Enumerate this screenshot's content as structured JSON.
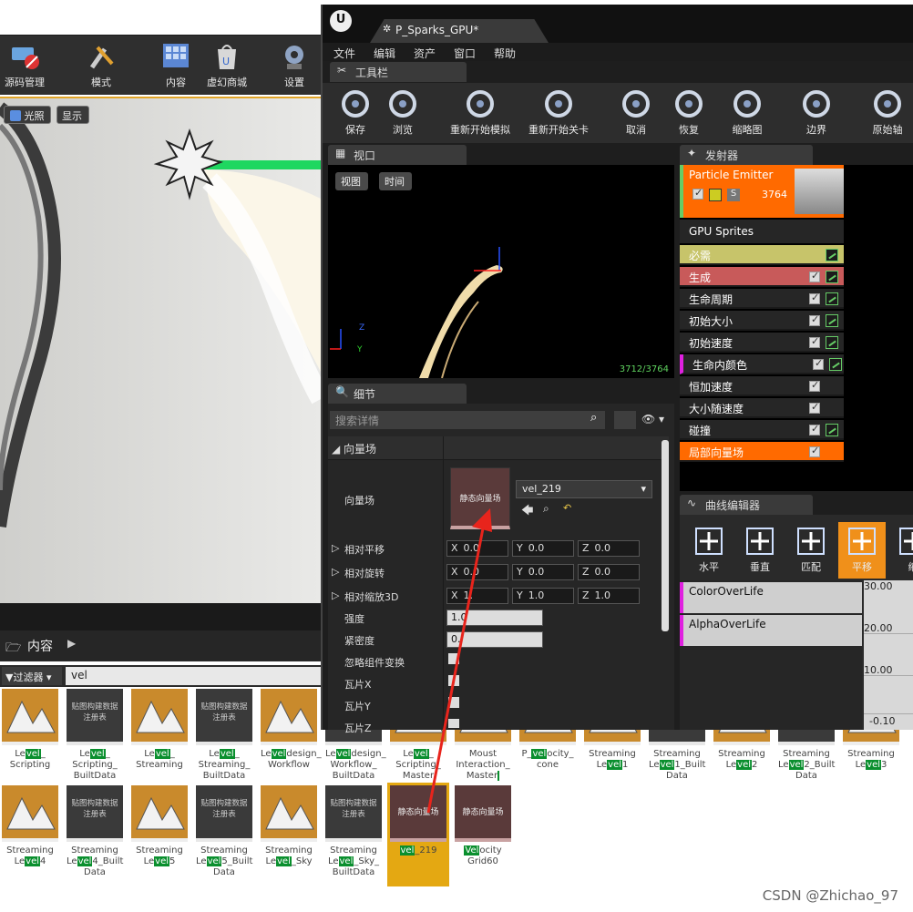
{
  "bg_toolbar": {
    "items": [
      {
        "label": "源码管理",
        "icon": "source-control-icon"
      },
      {
        "label": "模式",
        "icon": "modes-icon"
      },
      {
        "label": "内容",
        "icon": "content-icon"
      },
      {
        "label": "虚幻商城",
        "icon": "marketplace-icon"
      },
      {
        "label": "设置",
        "icon": "settings-icon"
      }
    ]
  },
  "bg_viewport": {
    "lit_label": "光照",
    "show_label": "显示"
  },
  "content_browser": {
    "title": "内容",
    "filter_label": "过滤器",
    "search_value": "vel"
  },
  "assets_row1": [
    {
      "pre": "Le",
      "hl": "vel",
      "post": "_ Scripting",
      "kind": "level"
    },
    {
      "pre": "Le",
      "hl": "vel",
      "post": "_ Scripting_ BuiltData",
      "kind": "tex",
      "thumb": "贴图构建数据 注册表"
    },
    {
      "pre": "Le",
      "hl": "vel",
      "post": "_ Streaming",
      "kind": "level"
    },
    {
      "pre": "Le",
      "hl": "vel",
      "post": "_ Streaming_ BuiltData",
      "kind": "tex",
      "thumb": "贴图构建数据 注册表"
    },
    {
      "pre": "Le",
      "hl": "vel",
      "post": "design_ Workflow",
      "kind": "level"
    },
    {
      "pre": "Le",
      "hl": "vel",
      "post": "design_ Workflow_ BuiltData",
      "kind": "tex",
      "thumb": "贴图构建数据 注册表"
    },
    {
      "pre": "Le",
      "hl": "vel",
      "post": "_ Scripting_ Master",
      "kind": "level"
    },
    {
      "pre": "Moust Interaction_ Master",
      "hl": "",
      "post": "",
      "kind": "level"
    },
    {
      "pre": "P_",
      "hl": "vel",
      "post": "ocity_ cone",
      "kind": "level"
    },
    {
      "pre": "Streaming Le",
      "hl": "vel",
      "post": "1",
      "kind": "level"
    },
    {
      "pre": "Streaming Le",
      "hl": "vel",
      "post": "1_Built Data",
      "kind": "tex",
      "thumb": ""
    },
    {
      "pre": "Streaming Le",
      "hl": "vel",
      "post": "2",
      "kind": "level"
    },
    {
      "pre": "Streaming Le",
      "hl": "vel",
      "post": "2_Built Data",
      "kind": "tex",
      "thumb": ""
    },
    {
      "pre": "Streaming Le",
      "hl": "vel",
      "post": "3",
      "kind": "level"
    }
  ],
  "assets_row2": [
    {
      "pre": "Streaming Le",
      "hl": "vel",
      "post": "4",
      "kind": "level"
    },
    {
      "pre": "Streaming Le",
      "hl": "vel",
      "post": "4_Built Data",
      "kind": "tex",
      "thumb": "贴图构建数据 注册表"
    },
    {
      "pre": "Streaming Le",
      "hl": "vel",
      "post": "5",
      "kind": "level"
    },
    {
      "pre": "Streaming Le",
      "hl": "vel",
      "post": "5_Built Data",
      "kind": "tex",
      "thumb": "贴图构建数据 注册表"
    },
    {
      "pre": "Streaming Le",
      "hl": "vel",
      "post": "_Sky",
      "kind": "level"
    },
    {
      "pre": "Streaming Le",
      "hl": "vel",
      "post": "_Sky_ BuiltData",
      "kind": "tex",
      "thumb": "贴图构建数据 注册表"
    },
    {
      "pre": "",
      "hl": "vel",
      "post": "_219",
      "kind": "vec",
      "thumb": "静态向量场",
      "selected": true
    },
    {
      "pre": "",
      "hl": "Vel",
      "post": "ocity Grid60",
      "kind": "vec",
      "thumb": "静态向量场"
    }
  ],
  "cascade": {
    "tab_title": "P_Sparks_GPU*",
    "menu": [
      "文件",
      "编辑",
      "资产",
      "窗口",
      "帮助"
    ],
    "toolbar_tab": "工具栏",
    "toolbar": [
      {
        "label": "保存",
        "icon": "save-icon"
      },
      {
        "label": "浏览",
        "icon": "browse-icon"
      },
      {
        "label": "重新开始模拟",
        "icon": "restart-sim-icon"
      },
      {
        "label": "重新开始关卡",
        "icon": "restart-level-icon"
      },
      {
        "label": "取消",
        "icon": "undo-icon"
      },
      {
        "label": "恢复",
        "icon": "redo-icon"
      },
      {
        "label": "缩略图",
        "icon": "thumbnail-icon"
      },
      {
        "label": "边界",
        "icon": "bounds-icon"
      },
      {
        "label": "原始轴",
        "icon": "origin-axis-icon"
      }
    ],
    "viewport": {
      "tab": "视口",
      "view_btn": "视图",
      "time_btn": "时间",
      "stats": "3712/3764",
      "axis_z": "Z",
      "axis_y": "Y"
    },
    "details": {
      "tab": "细节",
      "search_placeholder": "搜索详情",
      "category": "向量场",
      "field_label": "向量场",
      "thumb_label": "静态向量场",
      "asset_value": "vel_219",
      "rows": [
        {
          "label": "相对平移",
          "x": "0.0",
          "y": "0.0",
          "z": "0.0"
        },
        {
          "label": "相对旋转",
          "x": "0.0",
          "y": "0.0",
          "z": "0.0"
        },
        {
          "label": "相对缩放3D",
          "x": "1.",
          "y": "1.0",
          "z": "1.0"
        }
      ],
      "strength_label": "强度",
      "strength_value": "1.0",
      "tightness_label": "紧密度",
      "tightness_value": "0.",
      "ignore_label": "忽略组件变换",
      "tile_x": "瓦片X",
      "tile_y": "瓦片Y",
      "tile_z": "瓦片Z",
      "x": "X",
      "y": "Y",
      "z": "Z"
    },
    "emitters": {
      "tab": "发射器",
      "name": "Particle Emitter",
      "count": "3764",
      "type": "GPU Sprites",
      "s_label": "S",
      "modules": [
        {
          "label": "必需",
          "color": "#c7c46a",
          "check": false,
          "graph": true
        },
        {
          "label": "生成",
          "color": "#c85a5a",
          "check": true,
          "graph": true
        },
        {
          "label": "生命周期",
          "color": "#262626",
          "check": true,
          "graph": true
        },
        {
          "label": "初始大小",
          "color": "#262626",
          "check": true,
          "graph": true
        },
        {
          "label": "初始速度",
          "color": "#262626",
          "check": true,
          "graph": true
        },
        {
          "label": "生命内颜色",
          "color": "#262626",
          "check": true,
          "graph": true
        },
        {
          "label": "恒加速度",
          "color": "#262626",
          "check": true,
          "graph": false
        },
        {
          "label": "大小随速度",
          "color": "#262626",
          "check": true,
          "graph": false
        },
        {
          "label": "碰撞",
          "color": "#262626",
          "check": true,
          "graph": true
        },
        {
          "label": "局部向量场",
          "color": "#ff6a00",
          "check": true,
          "graph": false
        }
      ]
    },
    "curve_editor": {
      "tab": "曲线编辑器",
      "buttons": [
        "水平",
        "垂直",
        "匹配",
        "平移",
        "缩"
      ],
      "tracks": [
        "ColorOverLife",
        "AlphaOverLife"
      ],
      "y_ticks": [
        "30.00",
        "20.00",
        "10.00",
        "-0.10"
      ]
    }
  },
  "watermark": "CSDN @Zhichao_97",
  "colors": {
    "accent": "#e2a527",
    "selected_module": "#ff6a00",
    "arrow": "#e8241c"
  }
}
